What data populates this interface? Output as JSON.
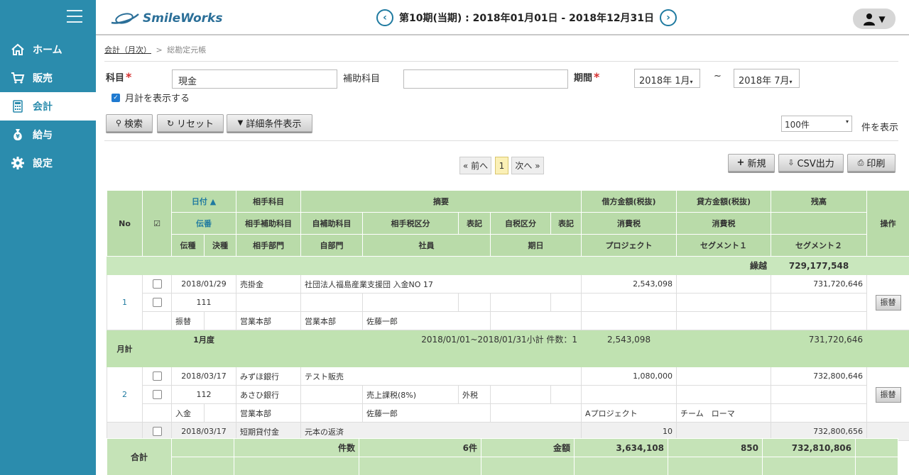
{
  "app": {
    "name": "SmileWorks",
    "user_caret": "▼"
  },
  "header": {
    "period": "第10期(当期) : 2018年01月01日 - 2018年12月31日",
    "prev": "‹",
    "next": "›"
  },
  "nav": [
    {
      "label": "ホーム",
      "icon": "home-icon"
    },
    {
      "label": "販売",
      "icon": "cart-icon"
    },
    {
      "label": "会計",
      "icon": "calculator-icon"
    },
    {
      "label": "給与",
      "icon": "money-bag-icon"
    },
    {
      "label": "設定",
      "icon": "gear-icon"
    }
  ],
  "breadcrumb": {
    "parent": "会計（月次）",
    "sep": ">",
    "current": "総勘定元帳"
  },
  "filters": {
    "account_label": "科目",
    "account_value": "現金",
    "sub_label": "補助科目",
    "sub_value": "",
    "period_label": "期間",
    "from": "2018年 1月",
    "to": "2018年 7月",
    "tilde": "~",
    "req": "*",
    "monthly_label": "月計を表示する"
  },
  "buttons": {
    "search": "検索",
    "reset": "リセット",
    "detail": "詳細条件表示",
    "new": "新規",
    "csv": "CSV出力",
    "print": "印刷",
    "per_page": "100件",
    "per_page_suffix": "件を表示"
  },
  "pager": {
    "prev": "« 前へ",
    "page": "1",
    "next": "次へ »"
  },
  "table": {
    "h": {
      "no": "No",
      "chk": "☑",
      "date": "日付 ▲",
      "counter": "相手科目",
      "summary": "摘要",
      "debit": "借方金額(税抜)",
      "credit": "貸方金額(税抜)",
      "balance": "残高",
      "ops": "操作",
      "slip": "伝番",
      "counter_sub": "相手補助科目",
      "self_sub": "自補助科目",
      "counter_tax": "相手税区分",
      "mark1": "表記",
      "self_tax": "自税区分",
      "mark2": "表記",
      "tax1": "消費税",
      "tax2": "消費税",
      "type": "伝種",
      "settle": "決種",
      "counter_dept": "相手部門",
      "self_dept": "自部門",
      "staff": "社員",
      "due": "期日",
      "project": "プロジェクト",
      "seg1": "セグメント１",
      "seg2": "セグメント２"
    },
    "carry": {
      "label": "繰越",
      "value": "729,177,548"
    },
    "e1": {
      "no": "1",
      "date": "2018/01/29",
      "counter": "売掛金",
      "summary": "社団法人福島産業支援団 入金NO 17",
      "debit": "2,543,098",
      "balance": "731,720,646",
      "slip": "111",
      "type": "振替",
      "counter_dept": "営業本部",
      "self_dept": "営業本部",
      "staff": "佐藤一郎",
      "op": "振替"
    },
    "m1": {
      "label": "月計",
      "period": "1月度",
      "sum": "2018/01/01~2018/01/31小計 件数：1",
      "debit": "2,543,098",
      "balance": "731,720,646"
    },
    "e2": {
      "no": "2",
      "date": "2018/03/17",
      "counter": "みずほ銀行",
      "summary": "テスト販売",
      "debit": "1,080,000",
      "balance": "732,800,646",
      "slip": "112",
      "counter_sub": "あさひ銀行",
      "counter_tax": "売上課税(8%)",
      "mark1": "外税",
      "type": "入金",
      "counter_dept": "営業本部",
      "staff": "佐藤一郎",
      "project": "Aプロジェクト",
      "seg1": "チーム　ローマ",
      "op": "振替"
    },
    "e3": {
      "date": "2018/03/17",
      "counter": "短期貸付金",
      "summary": "元本の返済",
      "debit": "10",
      "balance": "732,800,656"
    }
  },
  "footer": {
    "label": "合計",
    "count_label": "件数",
    "count": "6件",
    "amount_label": "金額",
    "debit": "3,634,108",
    "credit": "850",
    "balance": "732,810,806"
  }
}
